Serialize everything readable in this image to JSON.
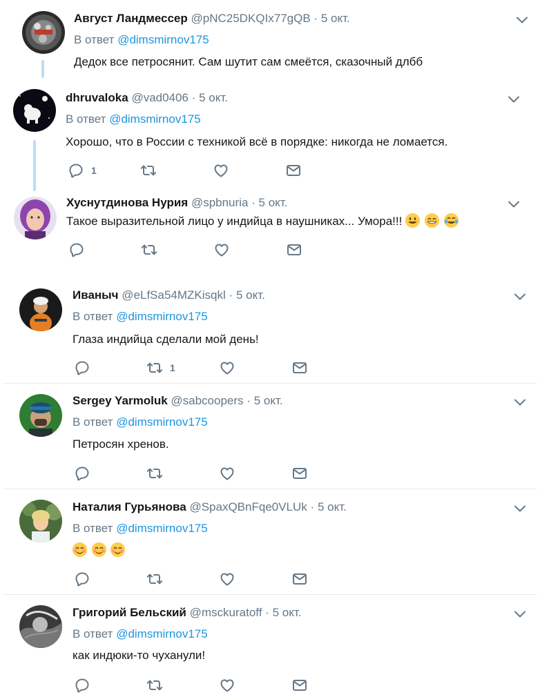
{
  "reply_prefix": "В ответ",
  "colors": {
    "link": "#1b95e0",
    "secondary": "#657786",
    "thread_line": "#b9def5",
    "separator": "#e6ecf0"
  },
  "tweets": [
    {
      "name": "Август Ландмессер",
      "handle": "@pNC25DKQIx77gQB",
      "dot": "·",
      "time": "5 окт.",
      "reply_mention": "@dimsmirnov175",
      "text": "Дедок все петросянит. Сам шутит сам смеётся, сказочный длбб",
      "has_actions": false
    },
    {
      "name": "dhruvaloka",
      "handle": "@vad0406",
      "dot": "·",
      "time": "5 окт.",
      "reply_mention": "@dimsmirnov175",
      "text": "Хорошо, что в России с техникой всё в порядке: никогда не ломается.",
      "reply_count": "1",
      "retweet_count": "",
      "has_actions": true
    },
    {
      "name": "Хуснутдинова Нурия",
      "handle": "@spbnuria",
      "dot": "·",
      "time": "5 окт.",
      "text": "Такое выразительной лицо у индийца в наушниках... Умора!!!",
      "emojis": [
        "grinning-face",
        "beaming-face",
        "tears-of-joy-face"
      ],
      "reply_count": "",
      "retweet_count": "",
      "has_actions": true
    },
    {
      "name": "Иваныч",
      "handle": "@eLfSa54MZKisqkl",
      "dot": "·",
      "time": "5 окт.",
      "reply_mention": "@dimsmirnov175",
      "text": "Глаза индийца сделали мой день!",
      "reply_count": "",
      "retweet_count": "1",
      "has_actions": true
    },
    {
      "name": "Sergey Yarmoluk",
      "handle": "@sabcoopers",
      "dot": "·",
      "time": "5 окт.",
      "reply_mention": "@dimsmirnov175",
      "text": "Петросян хренов.",
      "reply_count": "",
      "retweet_count": "",
      "has_actions": true
    },
    {
      "name": "Наталия Гурьянова",
      "handle": "@SpaxQBnFqe0VLUk",
      "dot": "·",
      "time": "5 окт.",
      "reply_mention": "@dimsmirnov175",
      "text": "",
      "emojis": [
        "smiling-face",
        "smiling-face",
        "smiling-face"
      ],
      "reply_count": "",
      "retweet_count": "",
      "has_actions": true
    },
    {
      "name": "Григорий Бельский",
      "handle": "@msckuratoff",
      "dot": "·",
      "time": "5 окт.",
      "reply_mention": "@dimsmirnov175",
      "text": "как индюки-то чуханули!",
      "reply_count": "",
      "retweet_count": "",
      "has_actions": true
    }
  ]
}
